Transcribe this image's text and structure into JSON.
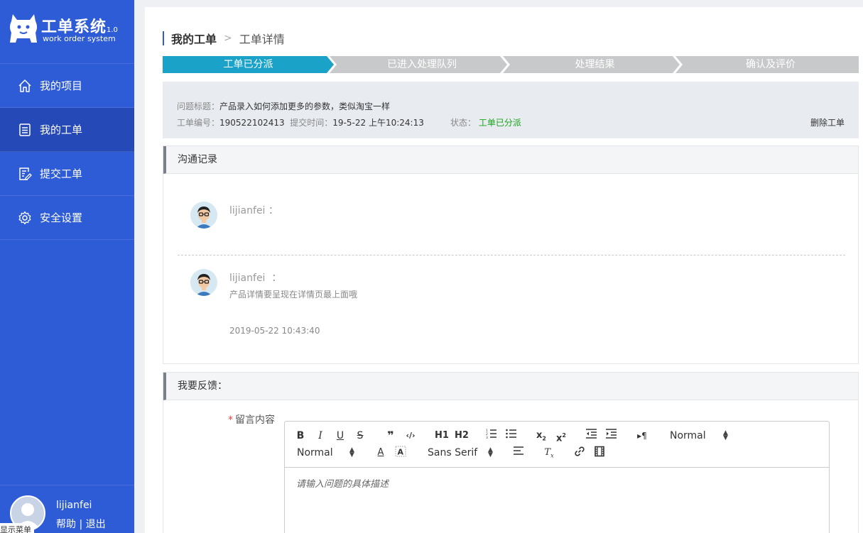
{
  "app": {
    "title": "工单系统",
    "version": "1.0",
    "subtitle": "work order system"
  },
  "sidebar": {
    "items": [
      {
        "label": "我的项目",
        "icon": "home-icon",
        "active": false
      },
      {
        "label": "我的工单",
        "icon": "list-document-icon",
        "active": true
      },
      {
        "label": "提交工单",
        "icon": "edit-document-icon",
        "active": false
      },
      {
        "label": "安全设置",
        "icon": "gear-icon",
        "active": false
      }
    ],
    "user": {
      "name": "lijianfei",
      "help": "帮助",
      "divider": "|",
      "logout": "退出",
      "menu_tip": "显示菜单"
    }
  },
  "breadcrumb": {
    "parent": "我的工单",
    "separator": ">",
    "current": "工单详情"
  },
  "steps": [
    {
      "label": "工单已分派",
      "active": true
    },
    {
      "label": "已进入处理队列",
      "active": false
    },
    {
      "label": "处理结果",
      "active": false
    },
    {
      "label": "确认及评价",
      "active": false
    }
  ],
  "ticket": {
    "title_label": "问题标题：",
    "title": "产品录入如何添加更多的参数，类似淘宝一样",
    "id_label": "工单编号：",
    "id": "190522102413",
    "time_label": "提交时间：",
    "time": "19-5-22 上午10:24:13",
    "status_label": "状态：",
    "status": "工单已分派",
    "delete": "删除工单"
  },
  "communication": {
    "header": "沟通记录",
    "messages": [
      {
        "user": "lijianfei",
        "colon": "：",
        "text": "",
        "time": ""
      },
      {
        "user": "lijianfei",
        "colon": "：",
        "text": "产品详情要呈现在详情页最上面哦",
        "time": "2019-05-22 10:43:40"
      }
    ]
  },
  "feedback": {
    "header": "我要反馈：",
    "required_mark": "*",
    "label": "留言内容",
    "placeholder": "请输入问题的具体描述",
    "toolbar": {
      "header_select": "Normal",
      "size_select": "Normal",
      "font_select": "Sans Serif",
      "h1": "H1",
      "h2": "H2",
      "quote": "❞",
      "code": "‹/›",
      "pilcrow": "▸¶"
    }
  },
  "colors": {
    "sidebar": "#2e5bd6",
    "sidebar_active": "#2549b6",
    "step_active": "#1aa2c9",
    "step_inactive": "#c8c9cb",
    "status": "#19a319"
  }
}
